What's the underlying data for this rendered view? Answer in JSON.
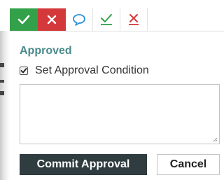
{
  "toolbar": {
    "buttons": [
      {
        "icon": "checkmark-icon",
        "color": "#33a04a"
      },
      {
        "icon": "x-icon",
        "color": "#d3393a"
      },
      {
        "icon": "comment-bubble-icon",
        "color": "#2a8fd6"
      },
      {
        "icon": "accept-underlined-check-icon",
        "color": "#33a04a"
      },
      {
        "icon": "reject-underlined-x-icon",
        "color": "#d3393a"
      }
    ]
  },
  "form": {
    "status_heading": "Approved",
    "status_color": "#4a8a8a",
    "checkbox_label": "Set Approval Condition",
    "checkbox_checked": true,
    "condition_text": ""
  },
  "actions": {
    "commit_label": "Commit Approval",
    "cancel_label": "Cancel",
    "commit_bg": "#2f3c40"
  }
}
